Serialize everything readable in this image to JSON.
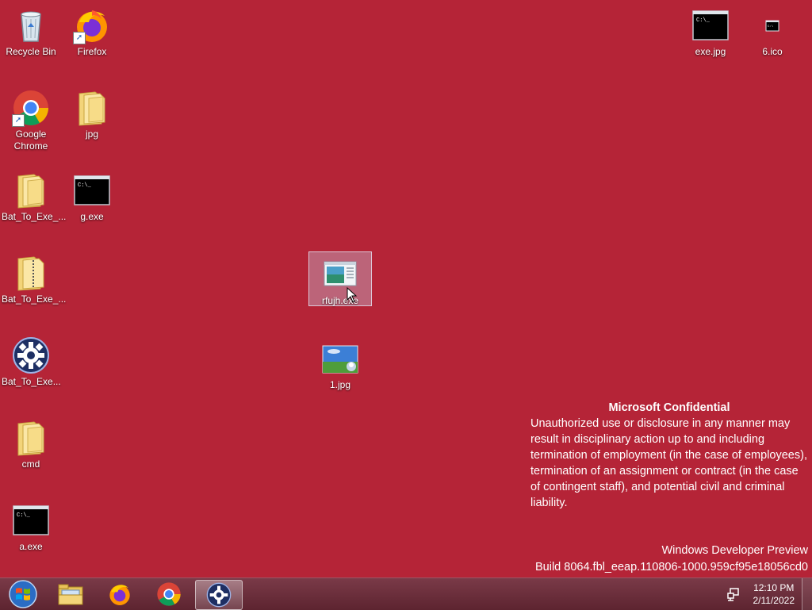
{
  "desktop": {
    "icons": {
      "recycle_bin": "Recycle Bin",
      "firefox": "Firefox",
      "google_chrome": "Google Chrome",
      "jpg_folder": "jpg",
      "bat_folder_1": "Bat_To_Exe_...",
      "g_exe": "g.exe",
      "bat_zip": "Bat_To_Exe_...",
      "bat_app": "Bat_To_Exe...",
      "cmd_folder": "cmd",
      "a_exe": "a.exe",
      "rfujh": "rfujh.exe",
      "one_jpg": "1.jpg",
      "exe_jpg": "exe.jpg",
      "six_ico": "6.ico"
    }
  },
  "watermark": {
    "title": "Microsoft Confidential",
    "body": "Unauthorized use or disclosure in any manner may result in disciplinary action up to and including termination of employment (in the case of employees), termination of an assignment or contract (in the case of contingent staff), and potential civil and criminal liability.",
    "os_name": "Windows Developer Preview",
    "build": "Build 8064.fbl_eeap.110806-1000.959cf95e18056cd0"
  },
  "taskbar": {
    "time": "12:10 PM",
    "date": "2/11/2022",
    "pinned": [
      "start-orb",
      "file-explorer-icon",
      "firefox-icon",
      "chrome-icon",
      "settings-gear-icon"
    ]
  },
  "colors": {
    "desktop_bg": "#b52437",
    "taskbar_bg": "#6a2c39"
  }
}
